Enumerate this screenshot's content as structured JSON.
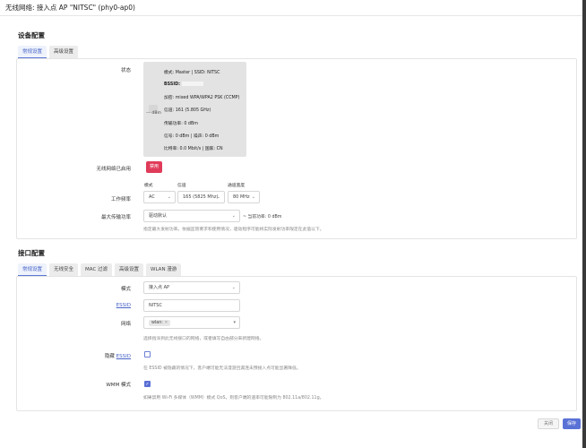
{
  "window": {
    "title": "无线网络: 接入点 AP \"NITSC\" (phy0-ap0)"
  },
  "device_config": {
    "title": "设备配置",
    "tabs": [
      {
        "label": "常规设置"
      },
      {
        "label": "高级设置"
      }
    ],
    "status_label": "状态",
    "status": {
      "mode_line": "模式: Master | SSID: NITSC",
      "bssid_label": "BSSID:",
      "encryption_line": "加密: mixed WPA/WPA2 PSK (CCMP)",
      "channel_line": "信道: 161 (5.805 GHz)",
      "tx_power_line": "传输功率: 0 dBm",
      "signal_noise_line": "信号: 0 dBm | 噪声: 0 dBm",
      "bitrate_country_line": "比特率: 0.0 Mbit/s | 国家: CN",
      "signal_value": "--- dBm"
    },
    "wireless_enabled_label": "无线网络已启用",
    "disable_button": "禁用",
    "freq_headers": {
      "mode": "模式",
      "channel": "信道",
      "width": "通道宽度"
    },
    "op_freq_label": "工作频率",
    "op_freq": {
      "mode": "AC",
      "channel": "165 (5825 Mhz)",
      "width": "80 MHz"
    },
    "max_tx_label": "最大传输功率",
    "max_tx_value": "驱动默认",
    "current_power": "~ 当前功率: 0 dBm",
    "max_tx_help": "指定最大发射功率。依据监管要求和使用情况，驱动程序可能将实际发射功率限定在此值以下。"
  },
  "interface_config": {
    "title": "接口配置",
    "tabs": [
      {
        "label": "常规设置"
      },
      {
        "label": "无线安全"
      },
      {
        "label": "MAC 过滤"
      },
      {
        "label": "高级设置"
      },
      {
        "label": "WLAN 漫游"
      }
    ],
    "mode_label": "模式",
    "mode_value": "接入点 AP",
    "essid_label": "ESSID",
    "essid_value": "NITSC",
    "network_label": "网络",
    "network_chip": "wlan: ",
    "network_help": "选择指派到此无线接口的网络，或者填写自由部分来新建网络。",
    "hide_essid_label": "隐藏 ESSID",
    "hide_essid_checked": false,
    "hide_essid_help": "在 ESSID 被隐藏的情况下，客户端可能无法漫游且漏连未预接入点可能显著降低。",
    "wmm_label": "WMM 模式",
    "wmm_checked": true,
    "wmm_help": "如果禁用 Wi-Fi 多媒体（WMM）模式 QoS，则客户端的速率可能限制为 802.11a/802.11g。"
  },
  "footer": {
    "close_label": "关闭",
    "save_label": "保存"
  },
  "colors": {
    "accent": "#5a72d6",
    "danger": "#e03b5a"
  }
}
